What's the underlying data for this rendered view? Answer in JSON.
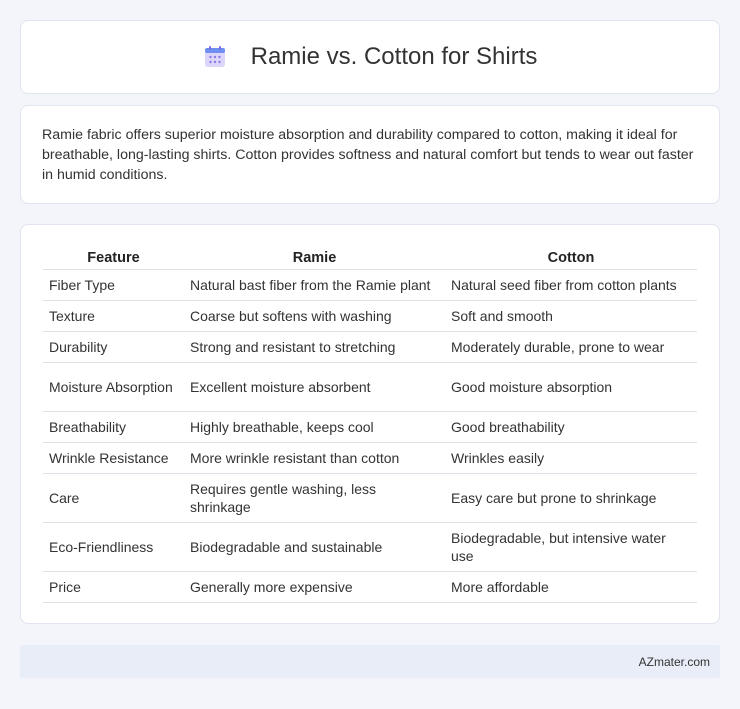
{
  "header": {
    "title": "Ramie vs. Cotton for Shirts",
    "icon": "calendar-icon"
  },
  "summary": {
    "text": "Ramie fabric offers superior moisture absorption and durability compared to cotton, making it ideal for breathable, long-lasting shirts. Cotton provides softness and natural comfort but tends to wear out faster in humid conditions."
  },
  "table": {
    "headers": [
      "Feature",
      "Ramie",
      "Cotton"
    ],
    "rows": [
      [
        "Fiber Type",
        "Natural bast fiber from the Ramie plant",
        "Natural seed fiber from cotton plants"
      ],
      [
        "Texture",
        "Coarse but softens with washing",
        "Soft and smooth"
      ],
      [
        "Durability",
        "Strong and resistant to stretching",
        "Moderately durable, prone to wear"
      ],
      [
        "Moisture Absorption",
        "Excellent moisture absorbent",
        "Good moisture absorption"
      ],
      [
        "Breathability",
        "Highly breathable, keeps cool",
        "Good breathability"
      ],
      [
        "Wrinkle Resistance",
        "More wrinkle resistant than cotton",
        "Wrinkles easily"
      ],
      [
        "Care",
        "Requires gentle washing, less shrinkage",
        "Easy care but prone to shrinkage"
      ],
      [
        "Eco-Friendliness",
        "Biodegradable and sustainable",
        "Biodegradable, but intensive water use"
      ],
      [
        "Price",
        "Generally more expensive",
        "More affordable"
      ]
    ]
  },
  "footer": {
    "brand": "AZmater.com"
  },
  "colors": {
    "page_background": "#f3f5fa",
    "card_background": "#ffffff",
    "footer_background": "#e8edf7"
  }
}
